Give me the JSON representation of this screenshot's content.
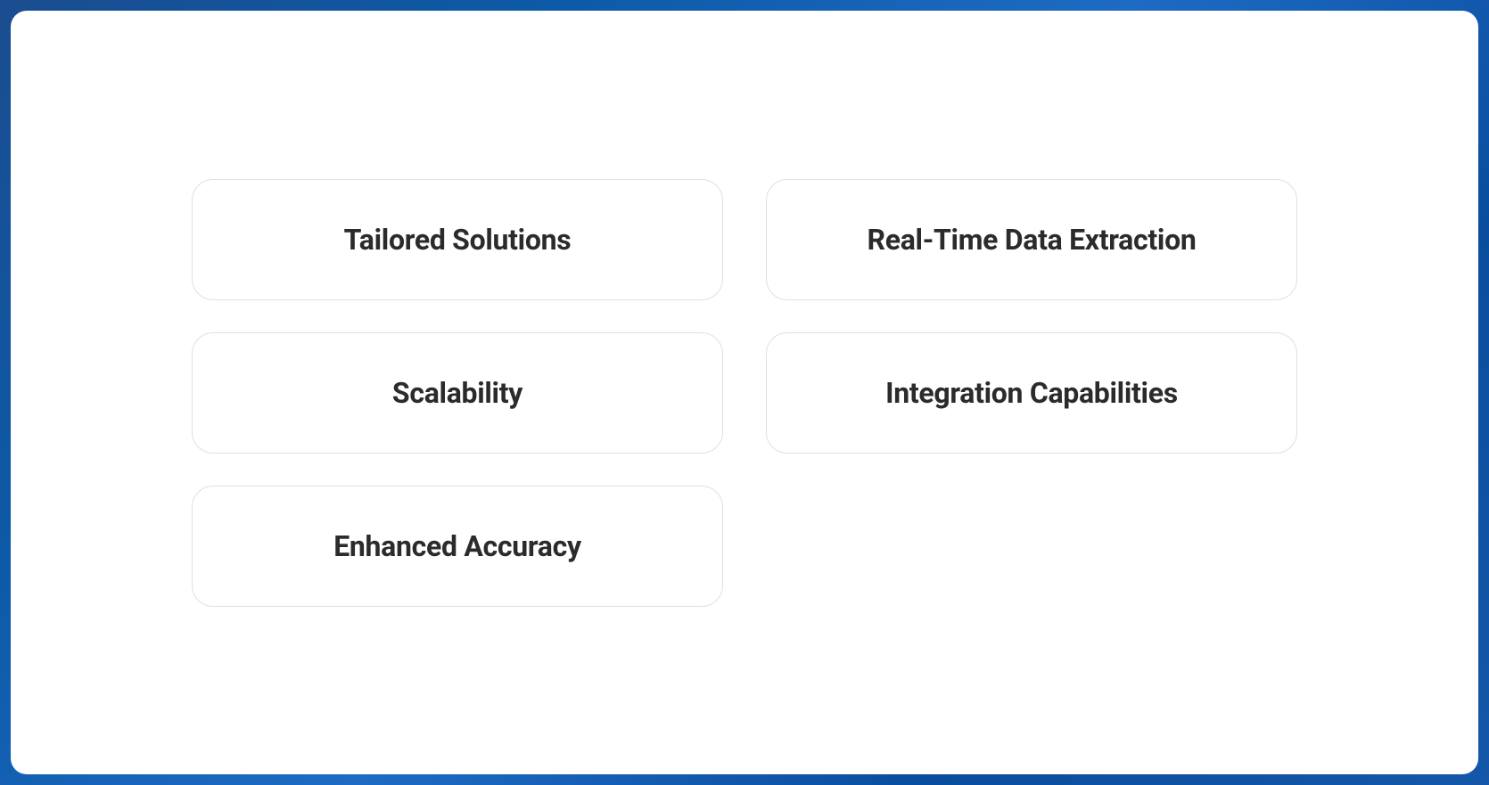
{
  "features": [
    {
      "title": "Tailored Solutions"
    },
    {
      "title": "Real-Time Data Extraction"
    },
    {
      "title": "Scalability"
    },
    {
      "title": "Integration Capabilities"
    },
    {
      "title": "Enhanced Accuracy"
    }
  ]
}
